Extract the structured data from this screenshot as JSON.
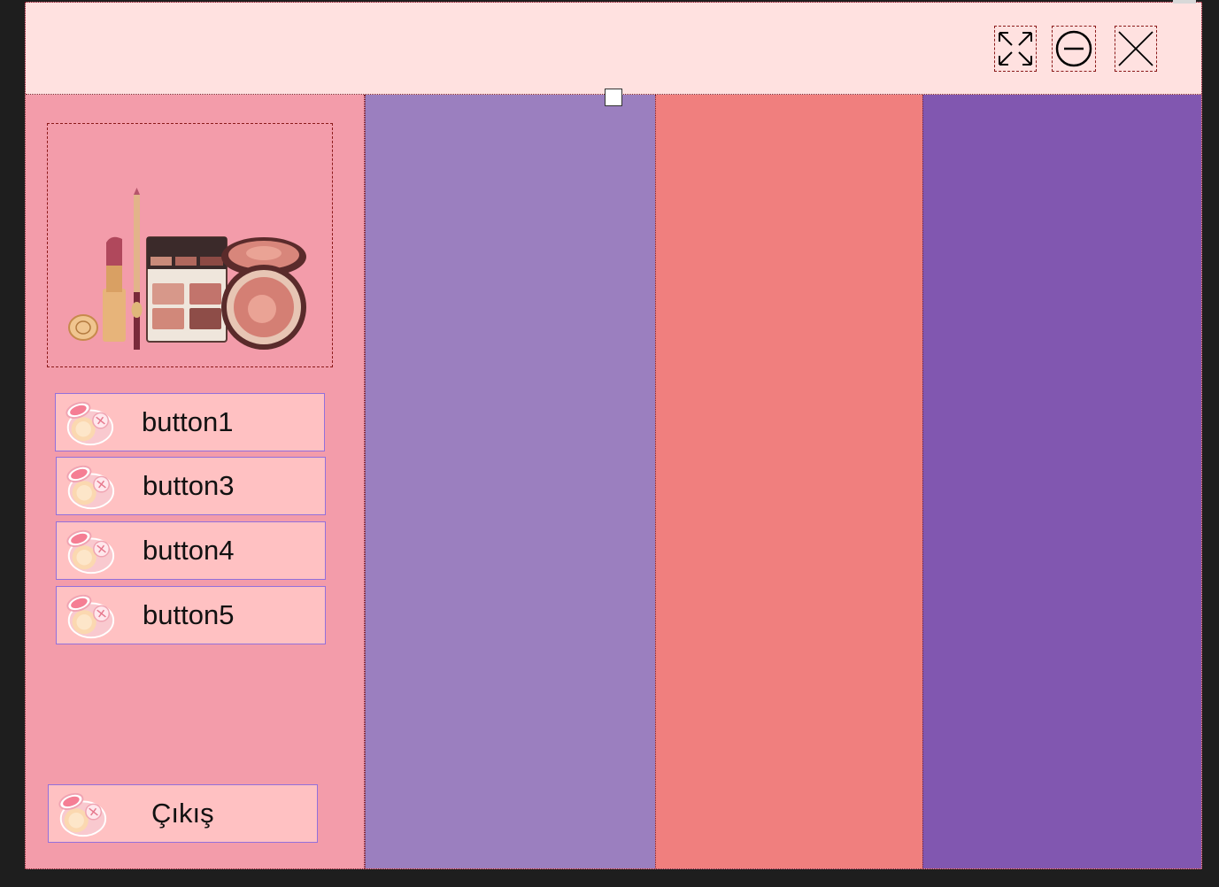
{
  "window": {
    "controls": [
      {
        "name": "maximize-button",
        "icon": "expand-arrows-icon"
      },
      {
        "name": "minimize-button",
        "icon": "circle-minus-icon"
      },
      {
        "name": "close-button",
        "icon": "x-icon"
      }
    ]
  },
  "sidebar": {
    "logo": {
      "icon": "makeup-products-image"
    },
    "buttons": [
      {
        "label": "button1",
        "icon": "compact-powder-icon"
      },
      {
        "label": "button3",
        "icon": "compact-powder-icon"
      },
      {
        "label": "button4",
        "icon": "compact-powder-icon"
      },
      {
        "label": "button5",
        "icon": "compact-powder-icon"
      }
    ],
    "exit_button": {
      "label": "Çıkış",
      "icon": "compact-powder-icon"
    }
  },
  "panels": [
    {
      "color": "#9b7fbf"
    },
    {
      "color": "#f07f7e"
    },
    {
      "color": "#8157b0"
    }
  ],
  "colors": {
    "titlebar": "#ffe1e0",
    "sidebar": "#f39caa",
    "button_bg": "#ffc1c2",
    "button_border": "#9370db"
  }
}
